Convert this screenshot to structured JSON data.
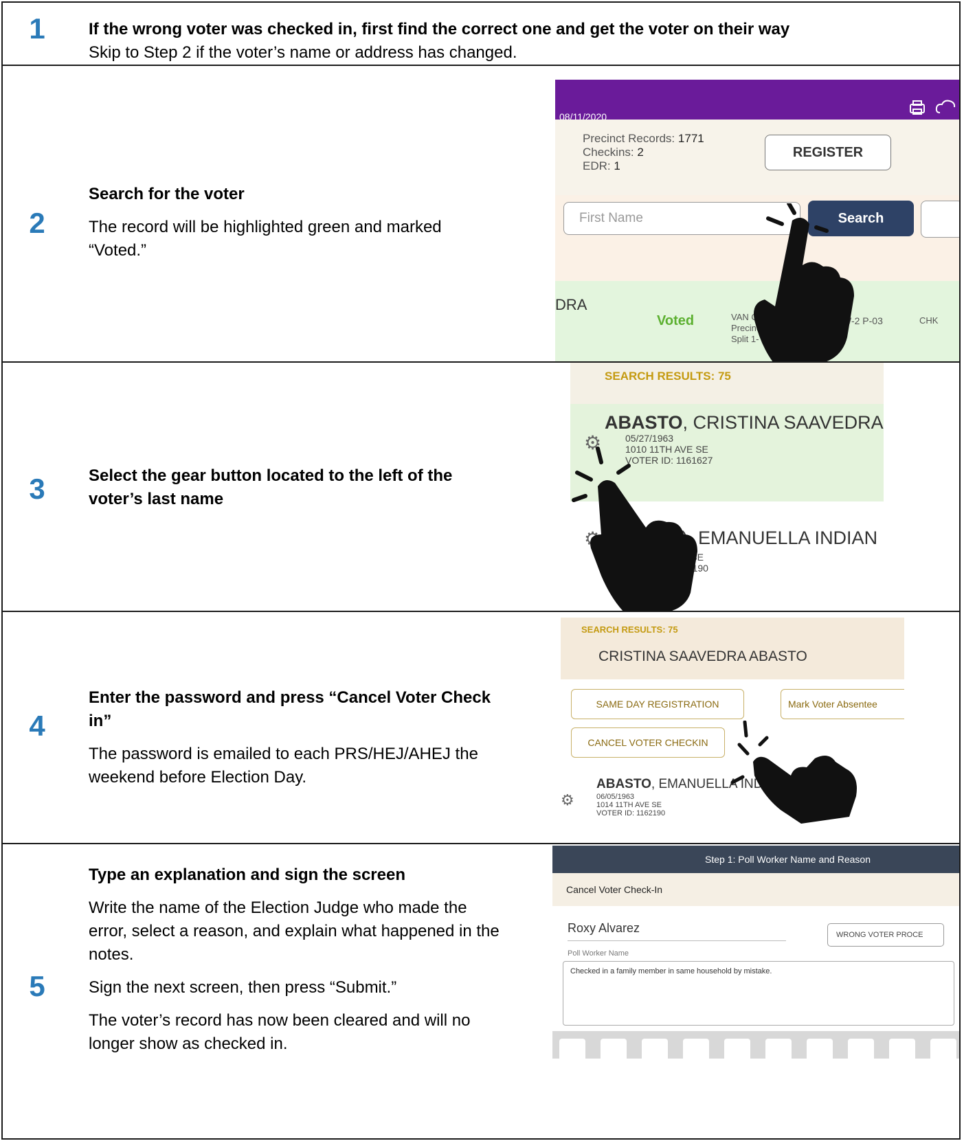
{
  "steps": [
    {
      "number": "1",
      "heading": "If the wrong voter was checked in, first find the correct one and get the voter on their way",
      "body": [
        "Skip to Step 2 if the voter’s name or address has changed."
      ]
    },
    {
      "number": "2",
      "heading": "Search for the voter",
      "body": [
        "The record will be highlighted green and marked “Voted.”"
      ]
    },
    {
      "number": "3",
      "heading": "Select the gear button located to the left of the voter’s last name",
      "body": []
    },
    {
      "number": "4",
      "heading": "Enter the password and press “Cancel Voter Check in”",
      "body": [
        "The password is emailed to each PRS/HEJ/AHEJ the weekend before Election Day."
      ]
    },
    {
      "number": "5",
      "heading": "Type an explanation and sign the screen",
      "body": [
        "Write the name of the Election Judge who made the error, select a reason, and explain what happened in the notes.",
        "Sign the next screen, then press “Submit.”",
        "The voter’s record has now been cleared and will no longer show as checked in."
      ]
    }
  ],
  "shot2": {
    "date": "08/11/2020",
    "precinct_label": "Precinct Records:",
    "precinct_value": "1771",
    "checkins_label": "Checkins:",
    "checkins_value": "2",
    "edr_label": "EDR:",
    "edr_value": "1",
    "register_label": "REGISTER",
    "first_name_placeholder": "First Name",
    "search_label": "Search",
    "row_name": "DRA",
    "row_status": "Voted",
    "row_meta_1": "VAN C",
    "row_meta_2": "Precinc",
    "row_meta_3": "Split 1-",
    "row_precinct": "W-2 P-03",
    "row_chk": "CHK",
    "icons": [
      "printer-icon",
      "cloud-icon",
      "hand-pointer-icon"
    ]
  },
  "shot3": {
    "results": "SEARCH RESULTS: 75",
    "voter1_last": "ABASTO",
    "voter1_rest": ", CRISTINA SAAVEDRA",
    "voter1_dob": "05/27/1963",
    "voter1_addr": "1010 11TH AVE SE",
    "voter1_id": "VOTER ID: 1161627",
    "voter2_name": "), EMANUELLA INDIAN",
    "voter2_addr": "E SE",
    "voter2_id": "52190"
  },
  "shot4": {
    "results": "SEARCH RESULTS: 75",
    "voter_name": "CRISTINA SAAVEDRA ABASTO",
    "same_day_label": "SAME DAY REGISTRATION",
    "absentee_label": "Mark Voter Absentee",
    "cancel_label": "CANCEL VOTER CHECKIN",
    "voter2_last": "ABASTO",
    "voter2_rest": ", EMANUELLA INDI",
    "voter2_dob": "06/05/1963",
    "voter2_addr": "1014 11TH AVE SE",
    "voter2_id": "VOTER ID: 1162190"
  },
  "shot5": {
    "header": "Step 1: Poll Worker Name and Reason",
    "subheader": "Cancel Voter Check-In",
    "poll_worker_value": "Roxy Alvarez",
    "poll_worker_label": "Poll Worker Name",
    "reason_label": "WRONG VOTER PROCE",
    "notes_value": "Checked in a family member in same household by mistake."
  }
}
